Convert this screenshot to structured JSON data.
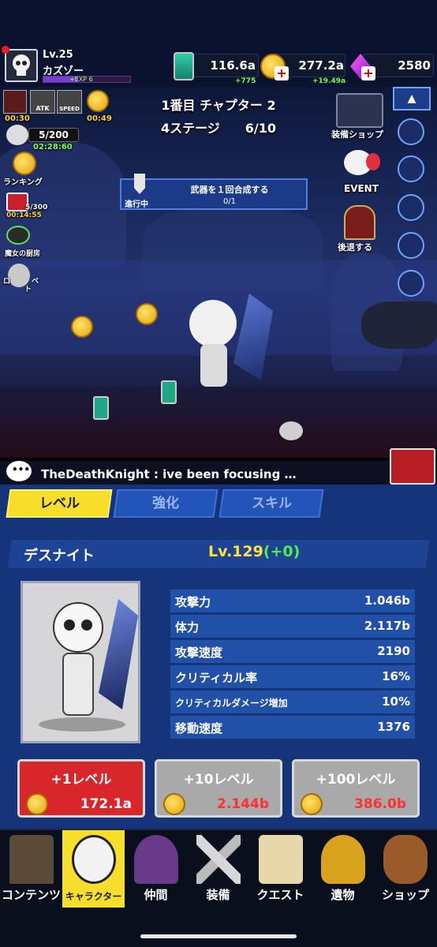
{
  "player": {
    "level": "Lv.25",
    "name": "カズゾー",
    "exp_label": "+EXP 6"
  },
  "currencies": [
    {
      "name": "energy",
      "value": "116.6a",
      "rate": "+775",
      "icon": "battery-icon"
    },
    {
      "name": "gold",
      "value": "277.2a",
      "rate": "+19.49a",
      "icon": "coin-icon"
    },
    {
      "name": "gems",
      "value": "2580",
      "rate": "",
      "icon": "gem-icon"
    }
  ],
  "buffs": {
    "atk_label": "ATK",
    "speed_label": "SPEED",
    "timer_1": "00:30",
    "timer_2": "00:49",
    "progress": "5/200",
    "timer_3": "02:28:60"
  },
  "left_menu": {
    "ranking": "ランキング",
    "timer_video": "00:14:55",
    "video_count": "5/300",
    "witch": "魔女の厨房",
    "roulette_partial": "ロ　　　ベ\n　　　ト"
  },
  "stage": {
    "chapter": "1番目 チャプター 2",
    "stage_line": "4ステージ　　6/10"
  },
  "quest": {
    "status": "進行中",
    "title": "武器を１回合成する",
    "progress": "0/1"
  },
  "right_menu": {
    "shop": "装備ショップ",
    "event": "EVENT",
    "retreat": "後退する"
  },
  "chat": {
    "message": "TheDeathKnight : ive been focusing …"
  },
  "tabs": [
    {
      "label": "レベル",
      "active": true
    },
    {
      "label": "強化",
      "active": false
    },
    {
      "label": "スキル",
      "active": false
    }
  ],
  "character": {
    "name": "デスナイト",
    "level": "Lv.129",
    "level_bonus": "(+0)"
  },
  "stats": [
    {
      "label": "攻撃力",
      "value": "1.046b"
    },
    {
      "label": "体力",
      "value": "2.117b"
    },
    {
      "label": "攻撃速度",
      "value": "2190"
    },
    {
      "label": "クリティカル率",
      "value": "16%"
    },
    {
      "label": "クリティカルダメージ増加",
      "value": "10%"
    },
    {
      "label": "移動速度",
      "value": "1376"
    }
  ],
  "level_buttons": [
    {
      "label": "+1レベル",
      "price": "172.1a",
      "enabled": true
    },
    {
      "label": "+10レベル",
      "price": "2.144b",
      "enabled": false
    },
    {
      "label": "+100レベル",
      "price": "386.0b",
      "enabled": false
    }
  ],
  "nav": [
    {
      "label": "コンテンツ",
      "active": false,
      "icon": "castle-icon"
    },
    {
      "label": "キャラクター",
      "active": true,
      "icon": "skull-icon"
    },
    {
      "label": "仲間",
      "active": false,
      "icon": "witch-icon"
    },
    {
      "label": "装備",
      "active": false,
      "icon": "crossed-swords-icon"
    },
    {
      "label": "クエスト",
      "active": false,
      "icon": "scroll-icon"
    },
    {
      "label": "遺物",
      "active": false,
      "icon": "trophy-icon"
    },
    {
      "label": "ショップ",
      "active": false,
      "icon": "treasure-bag-icon"
    }
  ],
  "colors": {
    "accent_yellow": "#f6de2a",
    "panel_blue": "#163479",
    "button_red": "#d8262a",
    "price_red": "#ff3030"
  }
}
